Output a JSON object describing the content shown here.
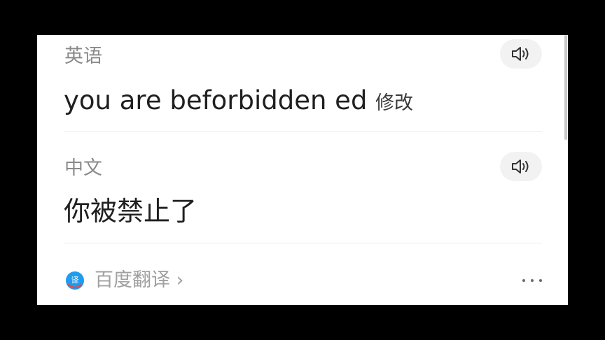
{
  "source": {
    "language_label": "英语",
    "text": "you are beforbidden ed",
    "edit_label": "修改",
    "speaker_icon": "speaker-icon"
  },
  "target": {
    "language_label": "中文",
    "text": "你被禁止了",
    "speaker_icon": "speaker-icon"
  },
  "footer": {
    "brand_label": "百度翻译 ›",
    "logo_icon": "baidu-translate-logo-icon",
    "more_icon": "more-dots-icon"
  },
  "colors": {
    "background": "#000000",
    "card": "#ffffff",
    "label": "#8a8a8a",
    "text": "#1f1f1f",
    "logo_blue": "#1e9cf0",
    "logo_red": "#e84848"
  }
}
